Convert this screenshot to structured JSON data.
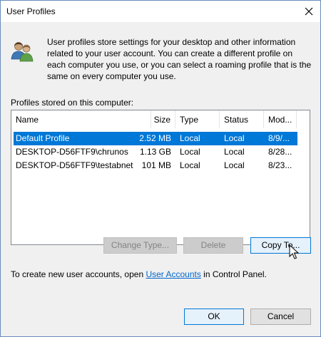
{
  "window": {
    "title": "User Profiles"
  },
  "description": "User profiles store settings for your desktop and other information related to your user account. You can create a different profile on each computer you use, or you can select a roaming profile that is the same on every computer you use.",
  "profiles_label": "Profiles stored on this computer:",
  "columns": {
    "name": "Name",
    "size": "Size",
    "type": "Type",
    "status": "Status",
    "modified": "Mod..."
  },
  "rows": [
    {
      "name": "Default Profile",
      "size": "2.52 MB",
      "type": "Local",
      "status": "Local",
      "modified": "8/9/...",
      "selected": true
    },
    {
      "name": "DESKTOP-D56FTF9\\chrunos",
      "size": "1.13 GB",
      "type": "Local",
      "status": "Local",
      "modified": "8/28...",
      "selected": false
    },
    {
      "name": "DESKTOP-D56FTF9\\testabnet",
      "size": "101 MB",
      "type": "Local",
      "status": "Local",
      "modified": "8/23...",
      "selected": false
    }
  ],
  "buttons": {
    "change_type": "Change Type...",
    "delete": "Delete",
    "copy_to": "Copy To...",
    "ok": "OK",
    "cancel": "Cancel"
  },
  "footer": {
    "prefix": "To create new user accounts, open ",
    "link": "User Accounts",
    "suffix": " in Control Panel."
  },
  "icons": {
    "close": "close-icon",
    "users": "users-icon",
    "cursor": "mouse-cursor-icon"
  },
  "colors": {
    "selection": "#0078d7",
    "link": "#0066cc",
    "window_border": "#6b8cba"
  }
}
